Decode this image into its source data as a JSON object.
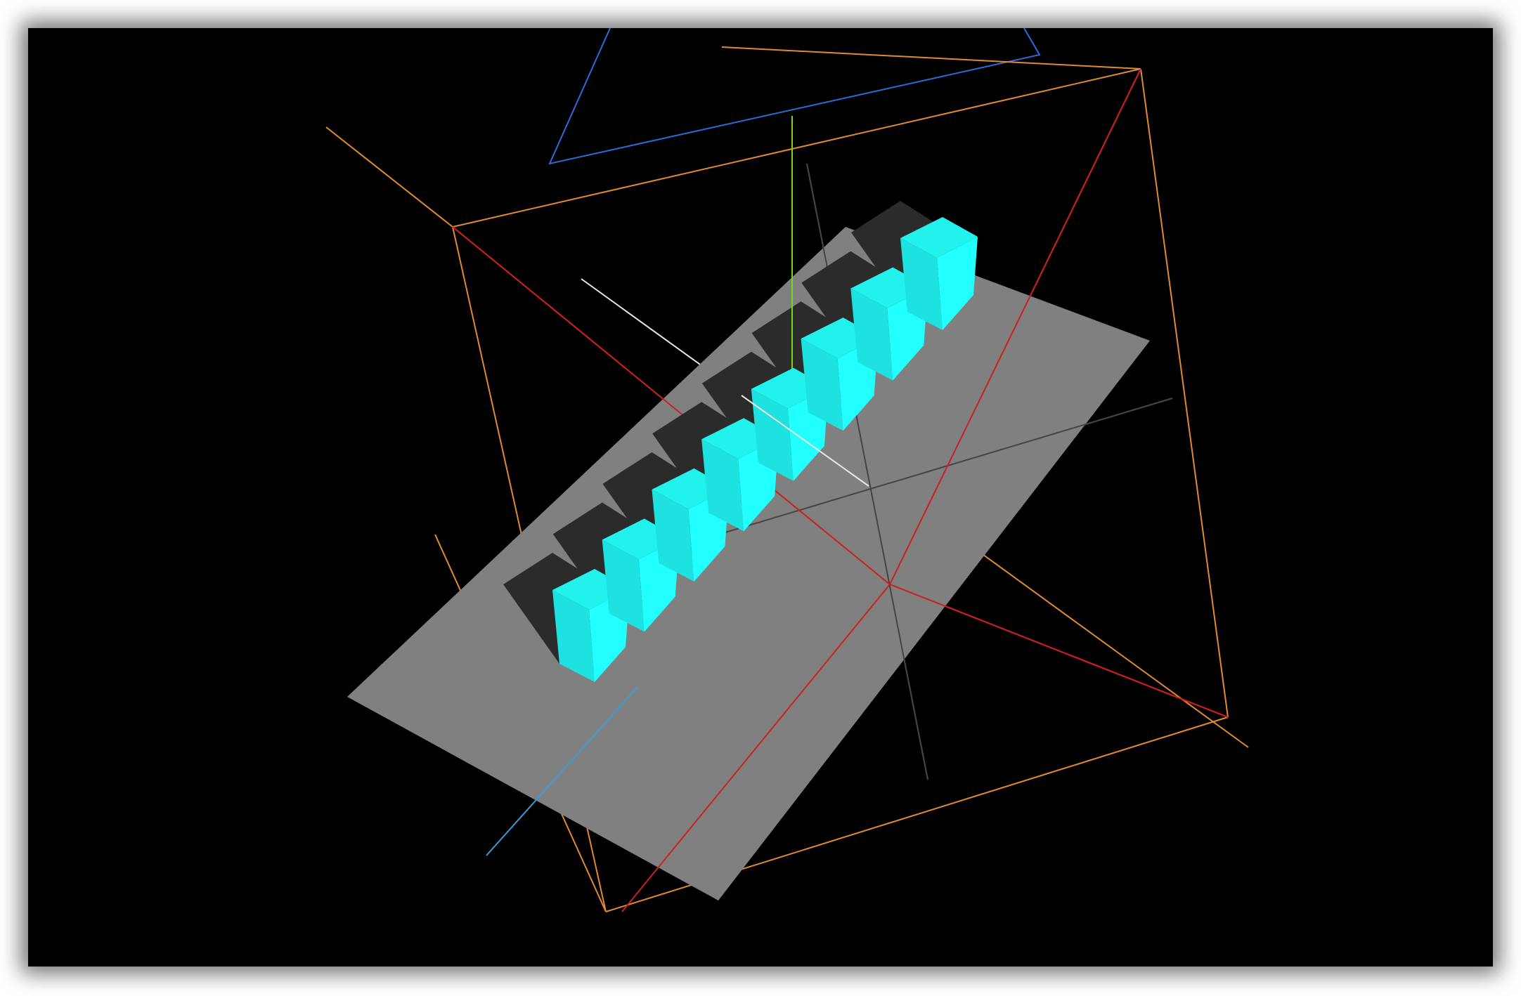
{
  "scene": {
    "background_color": "#000000",
    "ground_plane_color": "#808080",
    "box_color_top": "#22f2ec",
    "box_color_left": "#1ee2df",
    "box_color_right": "#22ffff",
    "shadow_color": "#2b2b2b",
    "light_frustum_color": "#e08a32",
    "camera_frustum_color": "#2f6bd8",
    "red_lines_color": "#cc1f1f",
    "axis_x_color": "#3a9bd8",
    "axis_y_color": "#7ed321",
    "axis_z_color": "#e8e8e8",
    "grid_line_color": "#555555",
    "box_count": 8
  }
}
